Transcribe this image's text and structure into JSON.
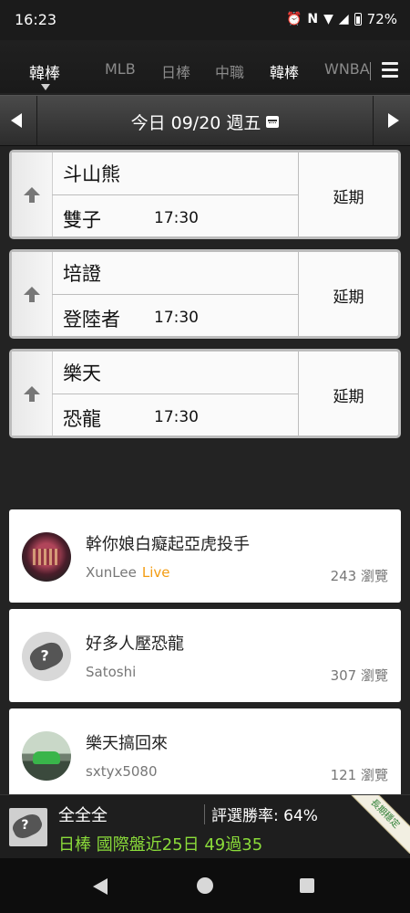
{
  "status_bar": {
    "time": "16:23",
    "battery": "72%",
    "icons": [
      "alarm-icon",
      "nfc-icon",
      "data-arrows-icon",
      "wifi-icon",
      "signal-icon",
      "battery-icon"
    ]
  },
  "league_tabs": {
    "current": "韓棒",
    "items": [
      "MLB",
      "日棒",
      "中職",
      "韓棒",
      "WNBA"
    ],
    "active": "韓棒"
  },
  "date_bar": {
    "label": "今日 09/20 週五"
  },
  "games": [
    {
      "away": "斗山熊",
      "home": "雙子",
      "time": "17:30",
      "status": "延期"
    },
    {
      "away": "培證",
      "home": "登陸者",
      "time": "17:30",
      "status": "延期"
    },
    {
      "away": "樂天",
      "home": "恐龍",
      "time": "17:30",
      "status": "延期"
    }
  ],
  "posts": [
    {
      "title": "幹你娘白癡起亞虎投手",
      "author": "XunLee",
      "live": "Live",
      "views": "243 瀏覽"
    },
    {
      "title": "好多人壓恐龍",
      "author": "Satoshi",
      "views": "307 瀏覽"
    },
    {
      "title": "樂天搞回來",
      "author": "sxtyx5080",
      "views": "121 瀏覽"
    }
  ],
  "expert": {
    "name": "全全全",
    "win_rate": "評選勝率: 64%",
    "record": "日棒 國際盤近25日 49過35",
    "ribbon": "長期穩定"
  },
  "colors": {
    "live": "#f39c12",
    "record": "#8bdc3a",
    "background": "#232323"
  }
}
